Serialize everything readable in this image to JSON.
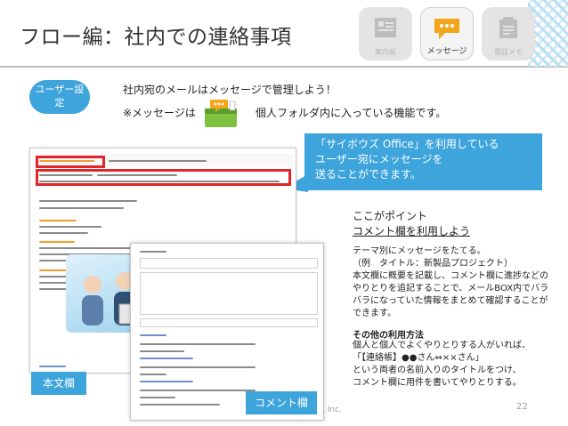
{
  "slide": {
    "title": "フロー編：社内での連絡事項",
    "page_number": "22",
    "copyright_fragment": ", Inc."
  },
  "features": [
    {
      "label": "案内板",
      "icon": "notice-board-icon",
      "active": false
    },
    {
      "label": "メッセージ",
      "icon": "speech-bubble-icon",
      "active": true
    },
    {
      "label": "電話メモ",
      "icon": "phone-memo-icon",
      "active": false
    }
  ],
  "user_settings_pill": "ユーザー設\n定",
  "intro": {
    "line1": "社内宛のメールはメッセージで管理しよう！",
    "line2_prefix": "※メッセージは",
    "line2_suffix": "個人フォルダ内に入っている機能です。"
  },
  "callout": {
    "text": "「サイボウズ Office」を利用している\nユーザー宛にメッセージを\n送ることができます。"
  },
  "point": {
    "line1": "ここがポイント",
    "line2": "コメント欄を利用しよう",
    "body": "テーマ別にメッセージをたてる。\n（例　タイトル：新製品プロジェクト）\n本文欄に概要を記載し、コメント欄に進捗などの\nやりとりを追記することで、メールBOX内でバラ\nバラになっていた情報をまとめて確認することが\nできます。"
  },
  "other_usage": {
    "heading": "その他の利用方法",
    "body": "個人と個人でよくやりとりする人がいれば、\n「【連絡帳】●●さん⇔××さん」\nという両者の名前入りのタイトルをつけ、\nコメント欄に用件を書いてやりとりする。"
  },
  "labels": {
    "body_field": "本文欄",
    "comment_field": "コメント欄"
  },
  "colors": {
    "accent": "#3ea4dc",
    "highlight_red": "#e0262b"
  }
}
